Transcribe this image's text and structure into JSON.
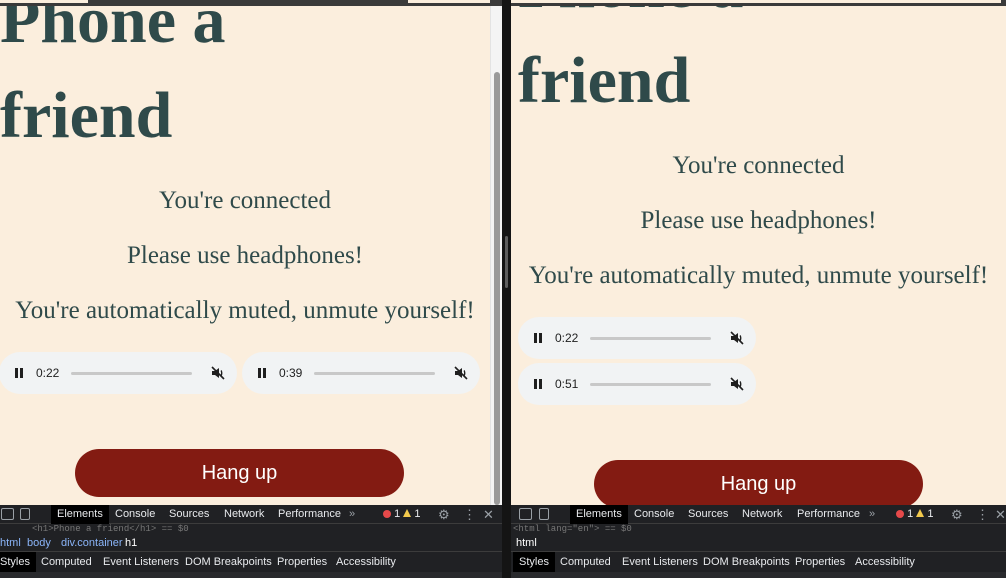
{
  "left_pane": {
    "title_line1": "Phone a",
    "title_line2": "friend",
    "messages": [
      "You're connected",
      "Please use headphones!",
      "You're automatically muted, unmute yourself!"
    ],
    "audio_players": [
      {
        "time": "0:22",
        "icon_play": "pause-icon",
        "icon_volume": "volume-muted-icon"
      },
      {
        "time": "0:39",
        "icon_play": "pause-icon",
        "icon_volume": "volume-muted-icon"
      }
    ],
    "hangup_label": "Hang up",
    "devtools": {
      "tabs": [
        "Elements",
        "Console",
        "Sources",
        "Network",
        "Performance"
      ],
      "more": "»",
      "errors": "1",
      "warnings": "1",
      "code_line": "<h1>Phone a friend</h1> == $0",
      "breadcrumbs": [
        "html",
        "body",
        "div.container",
        "h1"
      ],
      "subtabs": [
        "Styles",
        "Computed",
        "Event Listeners",
        "DOM Breakpoints",
        "Properties",
        "Accessibility"
      ]
    }
  },
  "right_pane": {
    "title_line1": "Phone a",
    "title_line2": "friend",
    "messages": [
      "You're connected",
      "Please use headphones!",
      "You're automatically muted, unmute yourself!"
    ],
    "audio_players": [
      {
        "time": "0:22",
        "icon_play": "pause-icon",
        "icon_volume": "volume-muted-icon"
      },
      {
        "time": "0:51",
        "icon_play": "pause-icon",
        "icon_volume": "volume-muted-icon"
      }
    ],
    "hangup_label": "Hang up",
    "devtools": {
      "tabs": [
        "Elements",
        "Console",
        "Sources",
        "Network",
        "Performance"
      ],
      "more": "»",
      "errors": "1",
      "warnings": "1",
      "code_line": "<html lang=\"en\"> == $0",
      "breadcrumbs": [
        "html"
      ],
      "subtabs": [
        "Styles",
        "Computed",
        "Event Listeners",
        "DOM Breakpoints",
        "Properties",
        "Accessibility"
      ]
    }
  },
  "colors": {
    "page_bg": "#fbeedd",
    "text": "#2f4a4a",
    "hangup_bg": "#831b12",
    "devtools_bg": "#202124",
    "link": "#8ab4f8"
  }
}
